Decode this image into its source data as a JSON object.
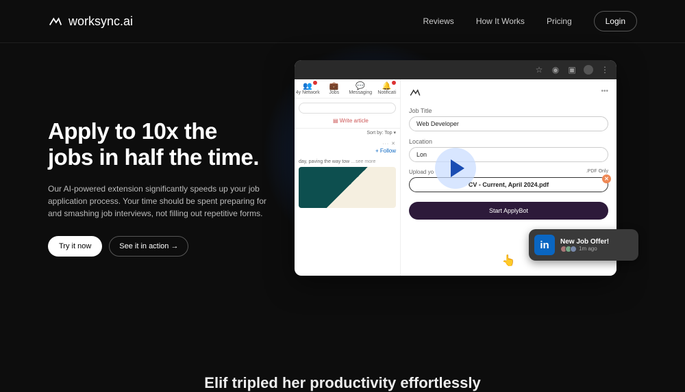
{
  "brand": "worksync.ai",
  "nav": {
    "reviews": "Reviews",
    "how": "How It Works",
    "pricing": "Pricing",
    "login": "Login"
  },
  "hero": {
    "title_line1": "Apply to 10x the",
    "title_line2": "jobs in half the time.",
    "sub": "Our AI-powered extension significantly speeds up your job application process. Your time should be spent preparing for and smashing job interviews, not filling out repetitive forms.",
    "try_btn": "Try it now",
    "action_btn": "See it in action →"
  },
  "feed": {
    "tabs": {
      "network": "4y Network",
      "jobs": "Jobs",
      "messaging": "Messaging",
      "notif": "Notificati"
    },
    "write": "Write article",
    "sort": "Sort by: Top ▾",
    "dots": "··· ✕",
    "follow": "+ Follow",
    "post_text": "day, paving the way tow",
    "seemore": "…see more"
  },
  "ext": {
    "job_label": "Job Title",
    "job_value": "Web Developer",
    "loc_label": "Location",
    "loc_value": "Lon",
    "upload_label": "Upload yo",
    "pdf_only": ".PDF Only",
    "file": "CV - Current, April 2024.pdf",
    "start": "Start ApplyBot"
  },
  "toast": {
    "title": "New Job Offer!",
    "time": "1m ago"
  },
  "bottom": "Elif tripled her productivity effortlessly"
}
